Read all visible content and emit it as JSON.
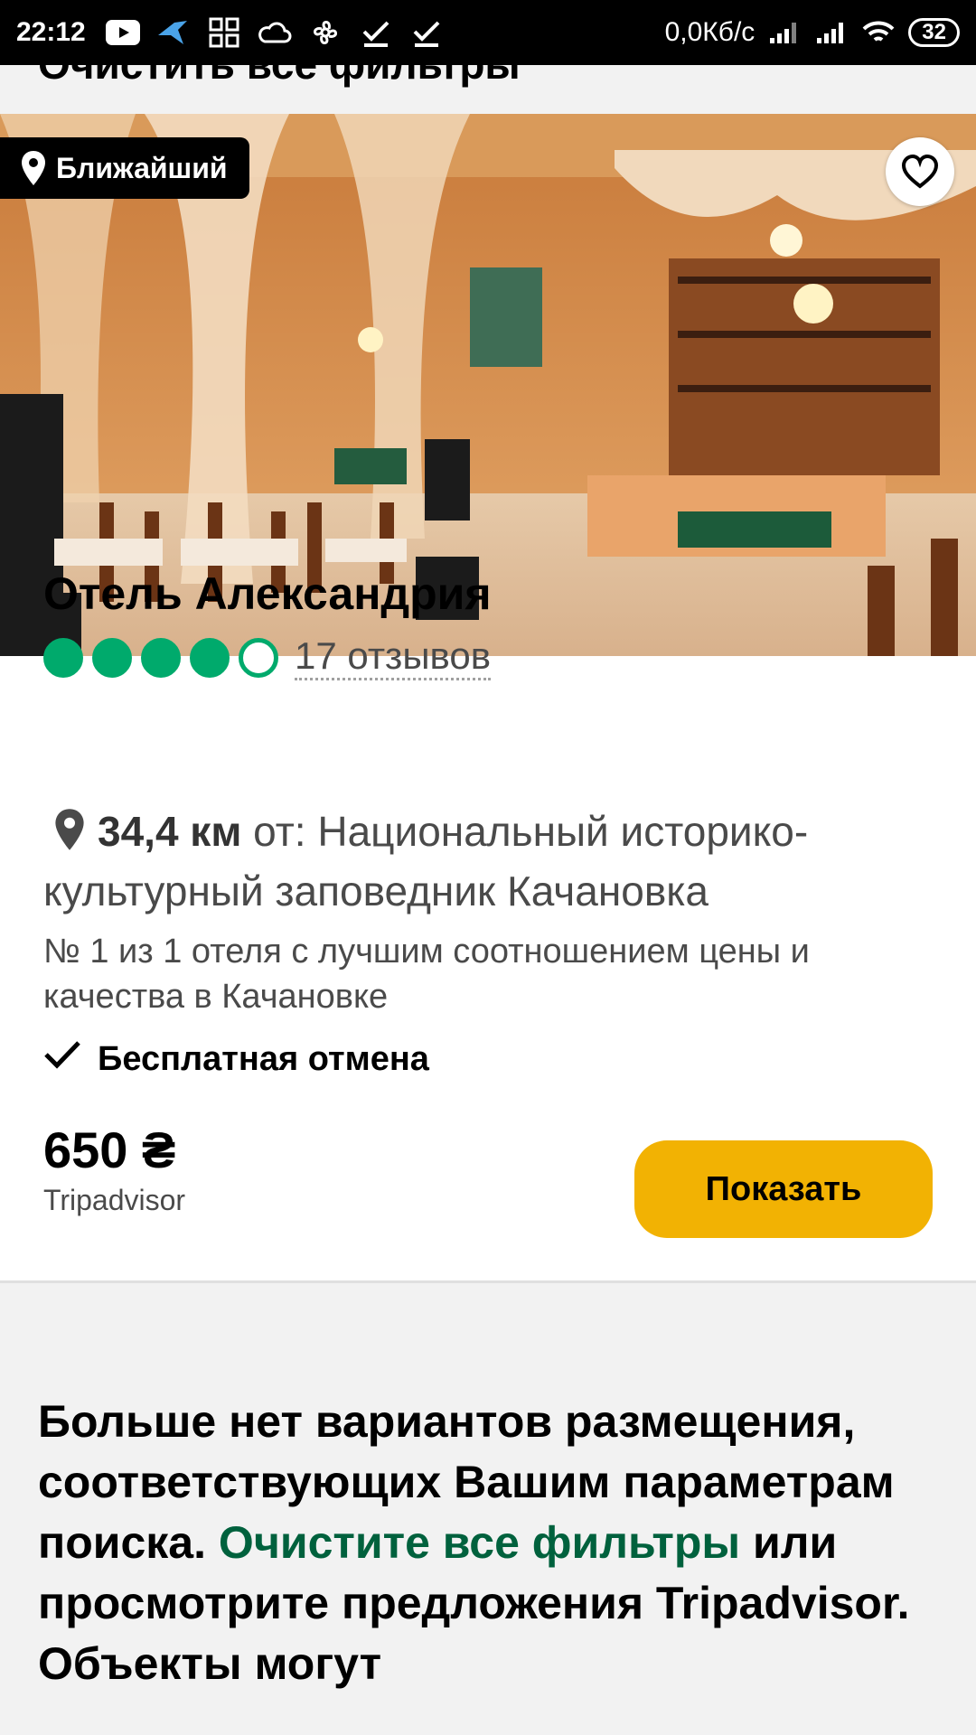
{
  "status_bar": {
    "time": "22:12",
    "net_speed": "0,0Кб/с",
    "battery": "32",
    "icons": [
      "youtube-icon",
      "bird-icon",
      "apps-icon",
      "cloud-icon",
      "fan-icon",
      "check-icon",
      "check-icon",
      "signal-icon",
      "signal-icon",
      "wifi-icon"
    ]
  },
  "top_clipped_text": "Очистить все фильтры",
  "listing": {
    "badge": "Ближайший",
    "name": "Отель Александрия",
    "rating_bubbles": 4,
    "rating_max": 5,
    "reviews": "17 отзывов",
    "distance_value": "34,4 км",
    "distance_text": "от: Национальный историко-культурный заповедник Качановка",
    "rank": "№ 1 из 1 отеля с лучшим соотношением цены и качества в Качановке",
    "free_cancel": "Бесплатная отмена",
    "price": "650 ₴",
    "provider": "Tripadvisor",
    "button": "Показать"
  },
  "no_more": {
    "part1": "Больше нет вариантов размещения, соответствующих Вашим параметрам поиска.",
    "link": "Очистите все фильтры",
    "part2": "или просмотрите предложения Tripadvisor. Объекты могут"
  },
  "colors": {
    "accent_green": "#00aa6c",
    "link_green": "#00613d",
    "button_yellow": "#f2b203"
  }
}
